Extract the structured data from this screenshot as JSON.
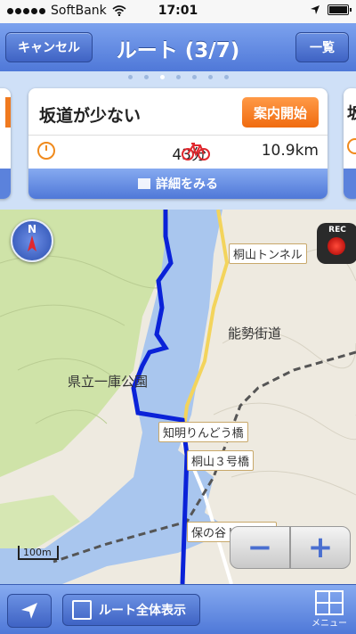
{
  "statusbar": {
    "carrier": "SoftBank",
    "time": "17:01"
  },
  "navbar": {
    "cancel_label": "キャンセル",
    "title": "ルート (3/7)",
    "list_label": "一覧"
  },
  "pager": {
    "count": 7,
    "active": 3
  },
  "card": {
    "title": "坂道が少ない",
    "start_label": "案内開始",
    "duration": "43分",
    "distance": "10.9km",
    "detail_label": "詳細をみる"
  },
  "peek_right": {
    "title_char": "坂"
  },
  "map": {
    "compass_label": "N",
    "rec_label": "REC",
    "labels": {
      "tunnel_kiriyama": "桐山トンネル",
      "nose_road": "能勢街道",
      "park": "県立一庫公園",
      "bridge_chimyo": "知明りんどう橋",
      "bridge_kiriyama3": "桐山３号橋",
      "tunnel_honoya": "保の谷トンネル"
    },
    "scale_label": "100m",
    "zoom_out": "−",
    "zoom_in": "+"
  },
  "bottombar": {
    "overview_label": "ルート全体表示",
    "menu_label": "メニュー"
  },
  "colors": {
    "accent": "#4f78d8",
    "route": "#0a22d8",
    "start_button": "#f07a1f",
    "water": "#a9c6ee",
    "forest": "#cfe3a8"
  }
}
